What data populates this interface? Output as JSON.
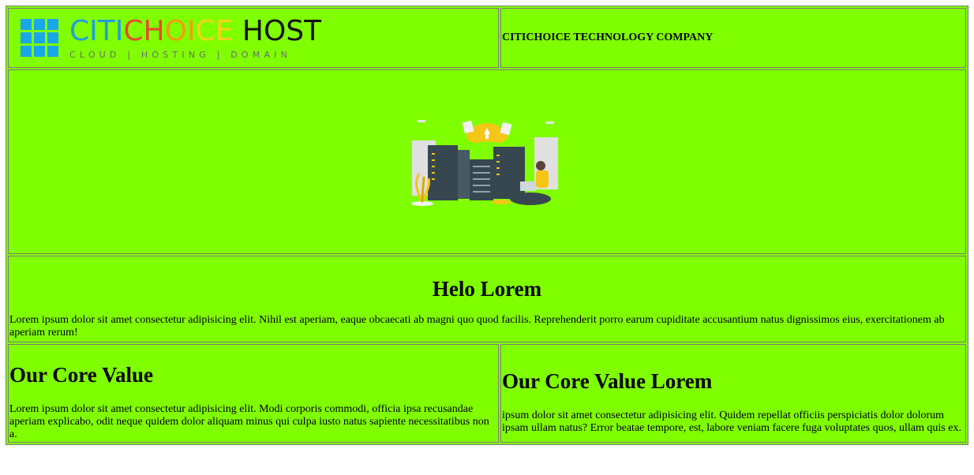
{
  "header": {
    "logo": {
      "name_parts": [
        "CITI",
        "C",
        "H",
        "O",
        "I",
        "CE",
        " HOST"
      ],
      "tagline": "CLOUD | HOSTING | DOMAIN"
    },
    "company_name": "CITICHOICE TECHNOLOGY COMPANY"
  },
  "illustration": {
    "icon": "server-room-illustration-icon"
  },
  "intro": {
    "heading": "Helo Lorem",
    "text": "Lorem ipsum dolor sit amet consectetur adipisicing elit. Nihil est aperiam, eaque obcaecati ab magni quo quod facilis. Reprehenderit porro earum cupiditate accusantium natus dignissimos eius, exercitationem ab aperiam rerum!"
  },
  "values": [
    {
      "heading": "Our Core Value",
      "text": "Lorem ipsum dolor sit amet consectetur adipisicing elit. Modi corporis commodi, officia ipsa recusandae aperiam explicabo, odit neque quidem dolor aliquam minus qui culpa iusto natus sapiente necessitatibus non a."
    },
    {
      "heading": "Our Core Value Lorem",
      "text": "ipsum dolor sit amet consectetur adipisicing elit. Quidem repellat officiis perspiciatis dolor dolorum ipsam ullam natus? Error beatae tempore, est, labore veniam facere fuga voluptates quos, ullam quis ex."
    }
  ],
  "colors": {
    "background": "#80ff00",
    "border": "#7a7a7a"
  }
}
